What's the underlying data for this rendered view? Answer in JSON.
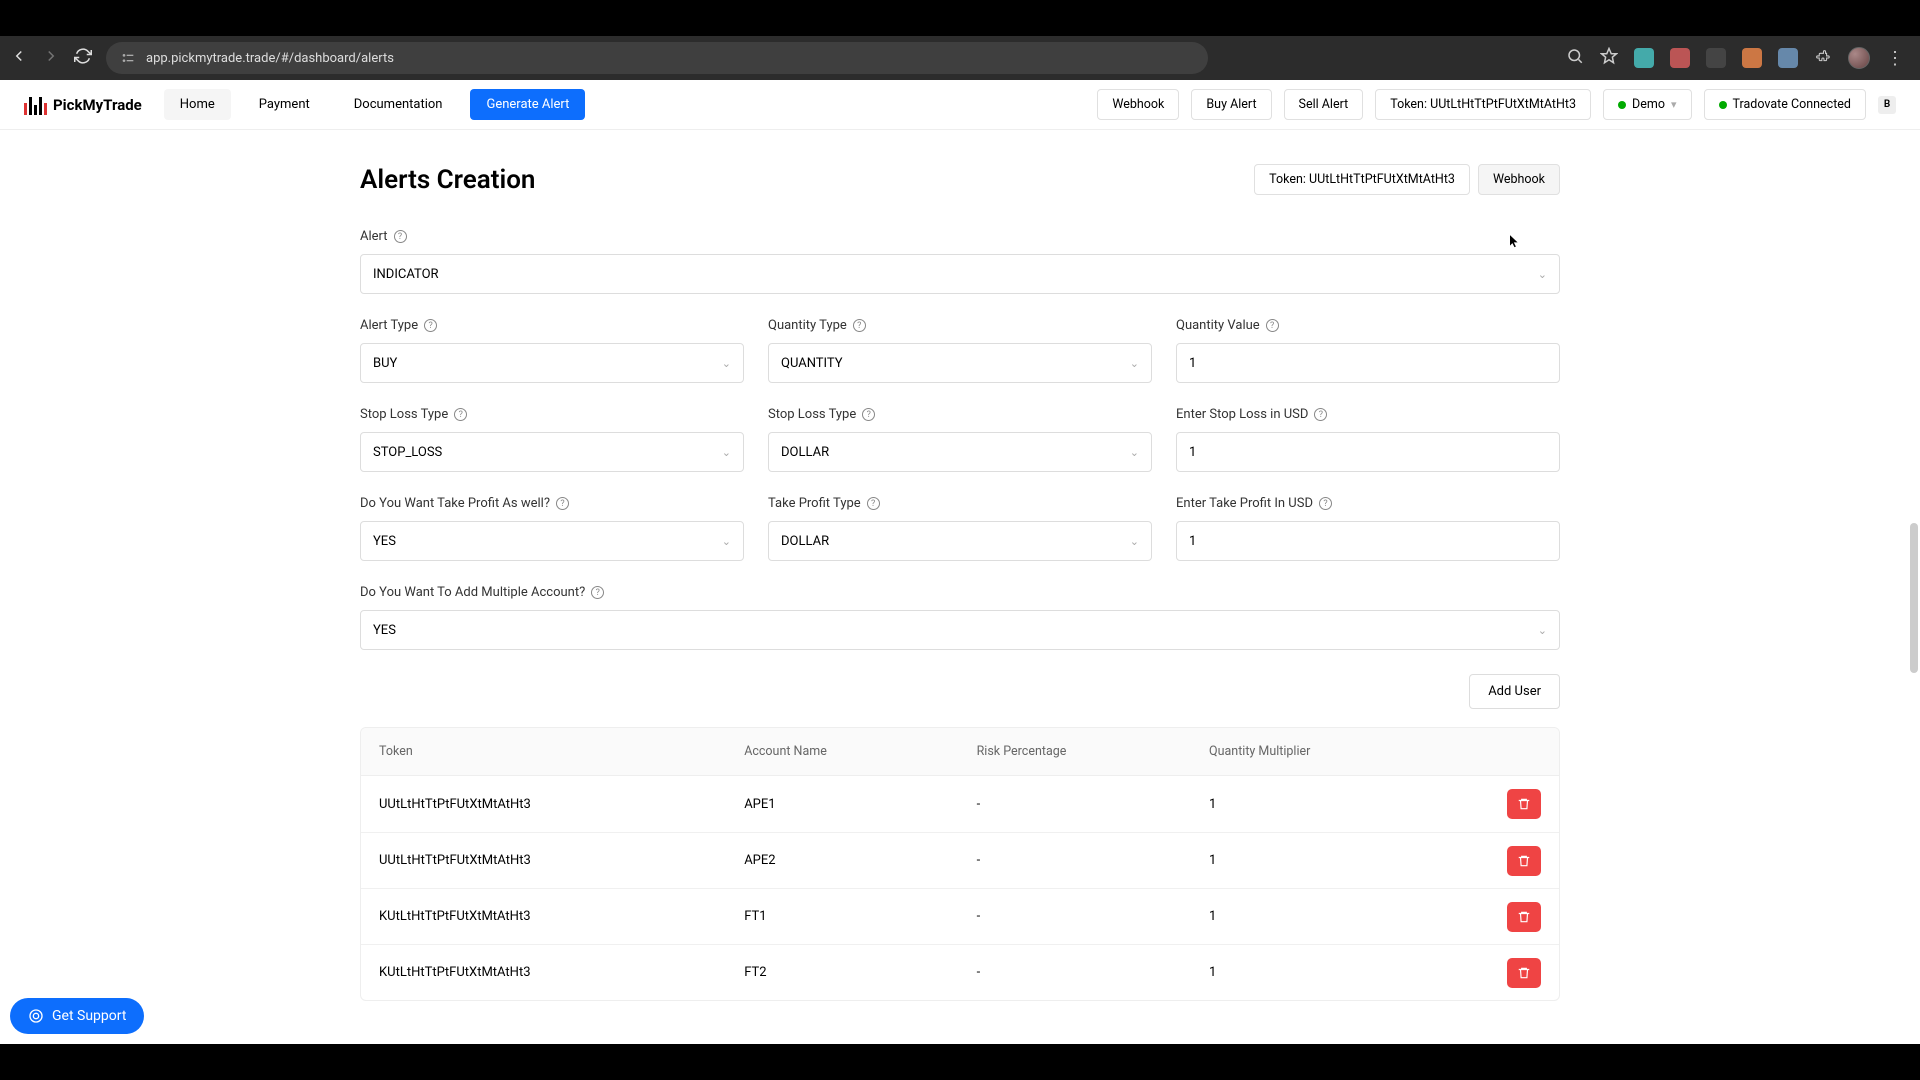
{
  "browser": {
    "url": "app.pickmytrade.trade/#/dashboard/alerts"
  },
  "brand": "PickMyTrade",
  "nav": {
    "home": "Home",
    "payment": "Payment",
    "documentation": "Documentation",
    "generate": "Generate Alert",
    "webhook": "Webhook",
    "buy_alert": "Buy Alert",
    "sell_alert": "Sell Alert",
    "token_pill": "Token: UUtLtHtTtPtFUtXtMtAtHt3",
    "demo": "Demo",
    "connected": "Tradovate Connected",
    "user_initial": "B"
  },
  "page": {
    "title": "Alerts Creation",
    "token_pill": "Token: UUtLtHtTtPtFUtXtMtAtHt3",
    "webhook": "Webhook"
  },
  "fields": {
    "alert_label": "Alert",
    "alert_value": "INDICATOR",
    "alert_type_label": "Alert Type",
    "alert_type_value": "BUY",
    "qty_type_label": "Quantity Type",
    "qty_type_value": "QUANTITY",
    "qty_value_label": "Quantity Value",
    "qty_value": "1",
    "sl_type_label": "Stop Loss Type",
    "sl_type_value": "STOP_LOSS",
    "sl_type2_label": "Stop Loss Type",
    "sl_type2_value": "DOLLAR",
    "sl_usd_label": "Enter Stop Loss in USD",
    "sl_usd_value": "1",
    "tp_want_label": "Do You Want Take Profit As well?",
    "tp_want_value": "YES",
    "tp_type_label": "Take Profit Type",
    "tp_type_value": "DOLLAR",
    "tp_usd_label": "Enter Take Profit In USD",
    "tp_usd_value": "1",
    "multi_label": "Do You Want To Add Multiple Account?",
    "multi_value": "YES"
  },
  "add_user": "Add User",
  "table": {
    "headers": {
      "token": "Token",
      "account": "Account Name",
      "risk": "Risk Percentage",
      "qty": "Quantity Multiplier"
    },
    "rows": [
      {
        "token": "UUtLtHtTtPtFUtXtMtAtHt3",
        "account": "APE1",
        "risk": "-",
        "qty": "1"
      },
      {
        "token": "UUtLtHtTtPtFUtXtMtAtHt3",
        "account": "APE2",
        "risk": "-",
        "qty": "1"
      },
      {
        "token": "KUtLtHtTtPtFUtXtMtAtHt3",
        "account": "FT1",
        "risk": "-",
        "qty": "1"
      },
      {
        "token": "KUtLtHtTtPtFUtXtMtAtHt3",
        "account": "FT2",
        "risk": "-",
        "qty": "1"
      }
    ]
  },
  "support": "Get Support"
}
